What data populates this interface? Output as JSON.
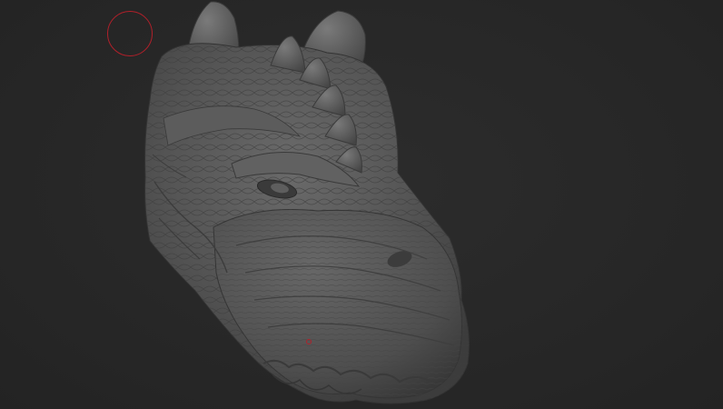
{
  "app": {
    "canvas_color": "#282828"
  },
  "viewport": {
    "model": {
      "icon": "dragon-head-sculpt",
      "surface_color": "#5a5a5a",
      "shadow_color": "#3a3a3a",
      "highlight_color": "#8a8a8a"
    },
    "brush": {
      "icon": "brush-radius-circle",
      "color": "#b0202a"
    }
  }
}
